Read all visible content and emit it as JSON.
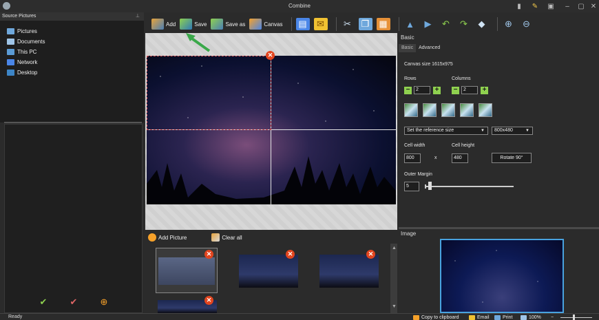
{
  "window": {
    "title": "Combine"
  },
  "left": {
    "header": "Source Pictures",
    "tree": [
      {
        "label": "Pictures",
        "color": "#6fa8dc"
      },
      {
        "label": "Documents",
        "color": "#9fc5e8"
      },
      {
        "label": "This PC",
        "color": "#5b9bd5"
      },
      {
        "label": "Network",
        "color": "#4a86e8"
      },
      {
        "label": "Desktop",
        "color": "#3d85c6"
      }
    ]
  },
  "toolbar": {
    "add_label": "Add",
    "save_label": "Save",
    "save_as_label": "Save as",
    "canvas_label": "Canvas"
  },
  "thumbnails": {
    "add_label": "Add Picture",
    "clear_label": "Clear all"
  },
  "right": {
    "section": "Basic",
    "tabs": [
      "Basic",
      "Advanced"
    ],
    "canvas_size": "Canvas size 1615x975",
    "rows_label": "Rows",
    "rows_value": "2",
    "columns_label": "Columns",
    "columns_value": "2",
    "reference_select": "Set the reference size",
    "size_select": "800x480",
    "cell_width_label": "Cell width",
    "cell_width_value": "800",
    "times": "x",
    "cell_height_label": "Cell height",
    "cell_height_value": "480",
    "rotate_label": "Rotate 90°",
    "outer_margin_label": "Outer Margin",
    "outer_margin_value": "5"
  },
  "image_panel": {
    "header": "Image"
  },
  "status": {
    "ready": "Ready",
    "copy": "Copy to clipboard",
    "email": "Email",
    "print": "Print",
    "zoom": "100%"
  },
  "colors": {
    "accent_green": "#8fd14f",
    "close_red": "#e2451f",
    "selection_blue": "#48a3e0"
  }
}
